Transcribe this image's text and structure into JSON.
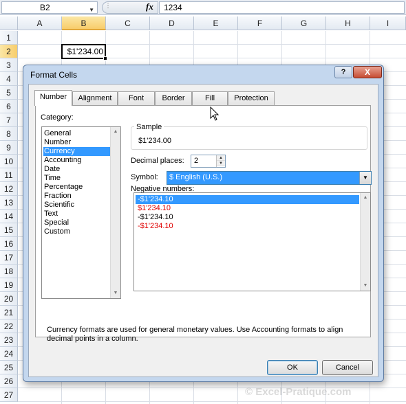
{
  "formula_bar": {
    "name_box": "B2",
    "fx_label": "fx",
    "formula": "1234"
  },
  "columns": [
    "A",
    "B",
    "C",
    "D",
    "E",
    "F",
    "G",
    "H",
    "I"
  ],
  "rows": [
    "1",
    "2",
    "3",
    "4",
    "5",
    "6",
    "7",
    "8",
    "9",
    "10",
    "11",
    "12",
    "13",
    "14",
    "15",
    "16",
    "17",
    "18",
    "19",
    "20",
    "21",
    "22",
    "23",
    "24",
    "25",
    "26",
    "27"
  ],
  "cell_b2": "$1'234.00",
  "dialog": {
    "title": "Format Cells",
    "help": "?",
    "close": "X",
    "tabs": [
      "Number",
      "Alignment",
      "Font",
      "Border",
      "Fill",
      "Protection"
    ],
    "category_label": "Category:",
    "categories": [
      "General",
      "Number",
      "Currency",
      "Accounting",
      "Date",
      "Time",
      "Percentage",
      "Fraction",
      "Scientific",
      "Text",
      "Special",
      "Custom"
    ],
    "selected_category": "Currency",
    "sample_label": "Sample",
    "sample_value": "$1'234.00",
    "decimal_places_label": "Decimal places:",
    "decimal_places": "2",
    "symbol_label": "Symbol:",
    "symbol_value": "$ English (U.S.)",
    "negative_label": "Negative numbers:",
    "negative_numbers": [
      {
        "text": "-$1'234.10",
        "color": "#ffffff",
        "selected": true
      },
      {
        "text": "$1'234.10",
        "color": "#e00000",
        "selected": false
      },
      {
        "text": "-$1'234.10",
        "color": "#000000",
        "selected": false
      },
      {
        "text": "-$1'234.10",
        "color": "#e00000",
        "selected": false
      }
    ],
    "description": "Currency formats are used for general monetary values.  Use Accounting formats to align decimal points in a column.",
    "ok_label": "OK",
    "cancel_label": "Cancel"
  },
  "watermark": "© Excel-Pratique.com"
}
